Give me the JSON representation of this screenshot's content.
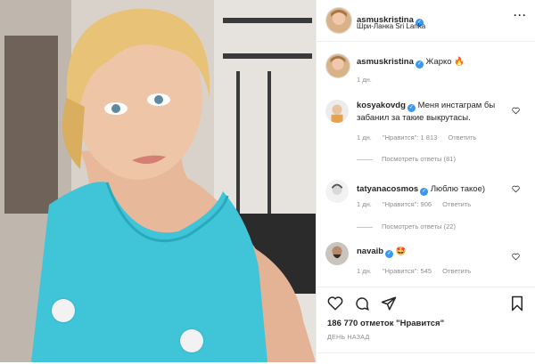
{
  "post": {
    "username": "asmuskristina",
    "location": "Шри-Ланка Sri Lanka",
    "caption_text": "Жарко",
    "caption_emoji": "🔥",
    "caption_time": "1 дн."
  },
  "comments": [
    {
      "username": "kosyakovdg",
      "verified": true,
      "text": "Меня инстаграм бы забанил за такие выкрутасы.",
      "time": "1 дн.",
      "likes": "\"Нравится\": 1 813",
      "reply": "Ответить",
      "view_replies": "Посмотреть ответы (81)"
    },
    {
      "username": "tatyanacosmos",
      "verified": true,
      "text": "Люблю такое)",
      "time": "1 дн.",
      "likes": "\"Нравится\": 906",
      "reply": "Ответить",
      "view_replies": "Посмотреть ответы (22)"
    },
    {
      "username": "navaib",
      "verified": true,
      "text": "🤩",
      "time": "1 дн.",
      "likes": "\"Нравится\": 545",
      "reply": "Ответить"
    }
  ],
  "actions": {
    "like_icon": "heart-icon",
    "comment_icon": "comment-icon",
    "share_icon": "paper-plane-icon",
    "save_icon": "bookmark-icon",
    "likes_count": "186 770 отметок \"Нравится\"",
    "posted": "ДЕНЬ НАЗАД"
  },
  "colors": {
    "verified": "#3897f0",
    "muted": "#8e8e8e",
    "text": "#262626",
    "top": "#40c4d8"
  }
}
